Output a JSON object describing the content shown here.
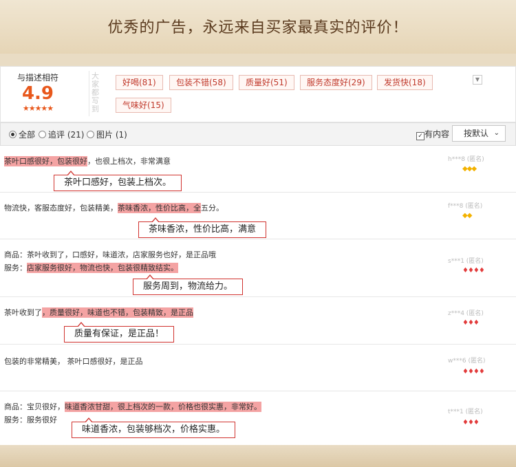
{
  "banner": {
    "title": "优秀的广告，永远来自买家最真实的评价！"
  },
  "summary": {
    "score_label": "与描述相符",
    "score": "4.9",
    "stars": "★★★★★",
    "tag_title": "大家都写到",
    "tags": [
      {
        "label": "好喝(81)"
      },
      {
        "label": "包装不错(58)"
      },
      {
        "label": "质量好(51)"
      },
      {
        "label": "服务态度好(29)"
      },
      {
        "label": "发货快(18)"
      },
      {
        "label": "气味好(15)"
      }
    ],
    "expand_icon": "chevron-down-icon"
  },
  "filter": {
    "all": "全部",
    "followup": "追评 (21)",
    "images": "图片 (1)",
    "has_content": "有内容",
    "sort": "按默认",
    "check_mark": "✓",
    "chevron": "⌄"
  },
  "reviews": [
    {
      "line1_hl": "茶叶口感很好，包装很好",
      "line1_rest": "，也很上档次，非常满意",
      "note": "茶叶口感好，包装上档次。",
      "reviewer": "h***8 (匿名)",
      "badge": "◆◆◆",
      "badge_color": "#f3b200"
    },
    {
      "line1_pre": "物流快，客服态度好，包装精美，",
      "line1_hl": "茶味香浓，性价比高，全",
      "line1_post": "五分。",
      "note": "茶味香浓，性价比高，满意",
      "reviewer": "f***8 (匿名)",
      "badge": "◆◆",
      "badge_color": "#f3b200"
    },
    {
      "line1": "商品：茶叶收到了，口感好，味道浓，店家服务也好，是正品哦",
      "line2_label": "服务：",
      "line2_hl": "店家服务很好，物流也快，包装很精致结实。",
      "note": "服务周到，物流给力。",
      "reviewer": "s***1 (匿名)",
      "badge": "♦♦♦♦",
      "badge_color": "#e23a3a"
    },
    {
      "line1_pre": "茶叶收到了",
      "line1_hl": "，质量很好，味道也不错，包装精致，是正品",
      "note": "质量有保证，是正品！",
      "reviewer": "z***4 (匿名)",
      "badge": "♦♦♦",
      "badge_color": "#e23a3a"
    },
    {
      "line1": "包装的非常精美， 茶叶口感很好，是正品",
      "reviewer": "w***6 (匿名)",
      "badge": "♦♦♦♦",
      "badge_color": "#e23a3a"
    },
    {
      "line1_pre": "商品：宝贝很好，",
      "line1_hl": "味道香浓甘甜，很上档次的一款，价格也很实惠，非常好。",
      "line2": "服务：服务很好",
      "note": "味道香浓，包装够档次，价格实惠。",
      "reviewer": "t***1 (匿名)",
      "badge": "♦♦♦",
      "badge_color": "#e23a3a"
    }
  ]
}
